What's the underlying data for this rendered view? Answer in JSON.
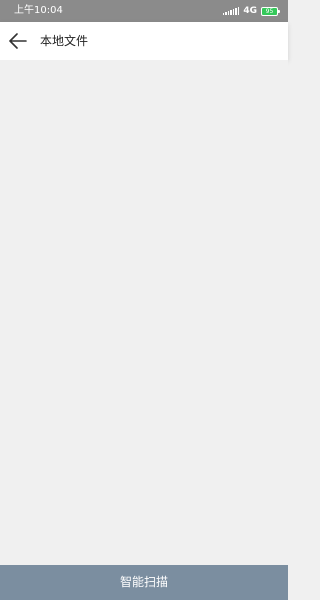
{
  "status_bar": {
    "time": "上午10:04",
    "network": "4G",
    "battery": "95",
    "battery_color": "#35c85a"
  },
  "app_bar": {
    "back_icon": "arrow-left-icon",
    "title": "本地文件"
  },
  "footer": {
    "scan_label": "智能扫描",
    "button_color": "#7b8ea0"
  }
}
